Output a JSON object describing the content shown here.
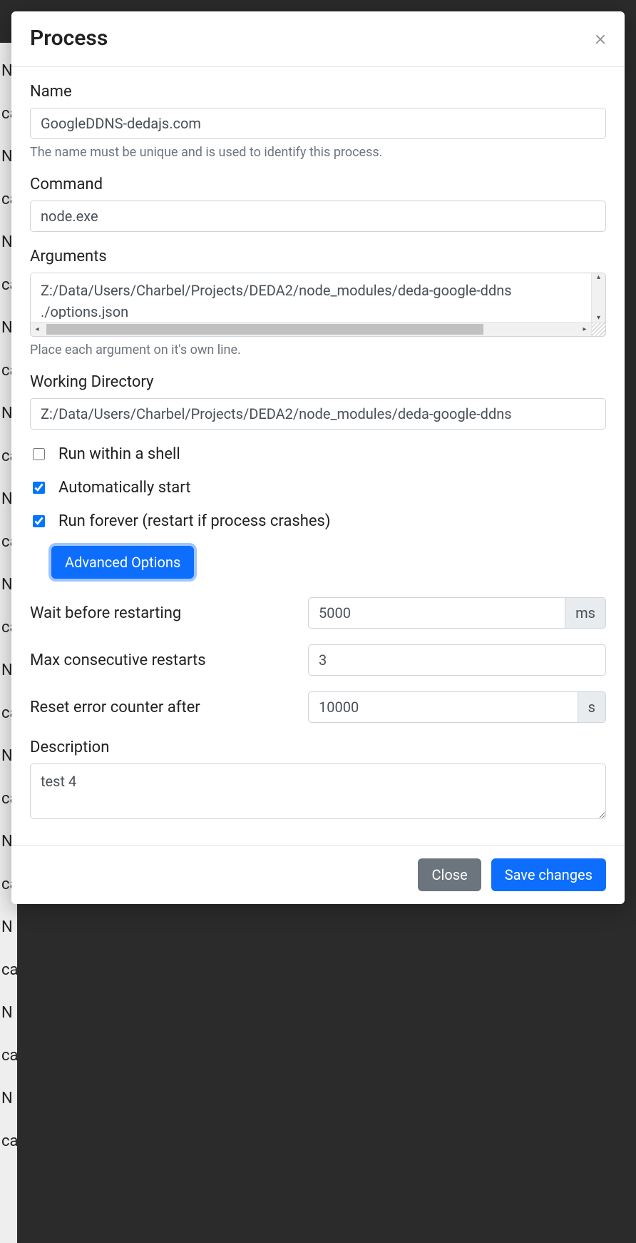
{
  "modal": {
    "title": "Process",
    "name_label": "Name",
    "name_value": "GoogleDDNS-dedajs.com",
    "name_help": "The name must be unique and is used to identify this process.",
    "command_label": "Command",
    "command_value": "node.exe",
    "arguments_label": "Arguments",
    "arguments_value": "Z:/Data/Users/Charbel/Projects/DEDA2/node_modules/deda-google-ddns\n./options.json",
    "arguments_help": "Place each argument on it's own line.",
    "workdir_label": "Working Directory",
    "workdir_value": "Z:/Data/Users/Charbel/Projects/DEDA2/node_modules/deda-google-ddns",
    "shell_label": "Run within a shell",
    "autostart_label": "Automatically start",
    "forever_label": "Run forever (restart if process crashes)",
    "advanced_button": "Advanced Options",
    "wait_label": "Wait before restarting",
    "wait_value": "5000",
    "wait_unit": "ms",
    "maxrestart_label": "Max consecutive restarts",
    "maxrestart_value": "3",
    "reset_label": "Reset error counter after",
    "reset_value": "10000",
    "reset_unit": "s",
    "description_label": "Description",
    "description_value": "test 4",
    "close_button": "Close",
    "save_button": "Save changes"
  }
}
